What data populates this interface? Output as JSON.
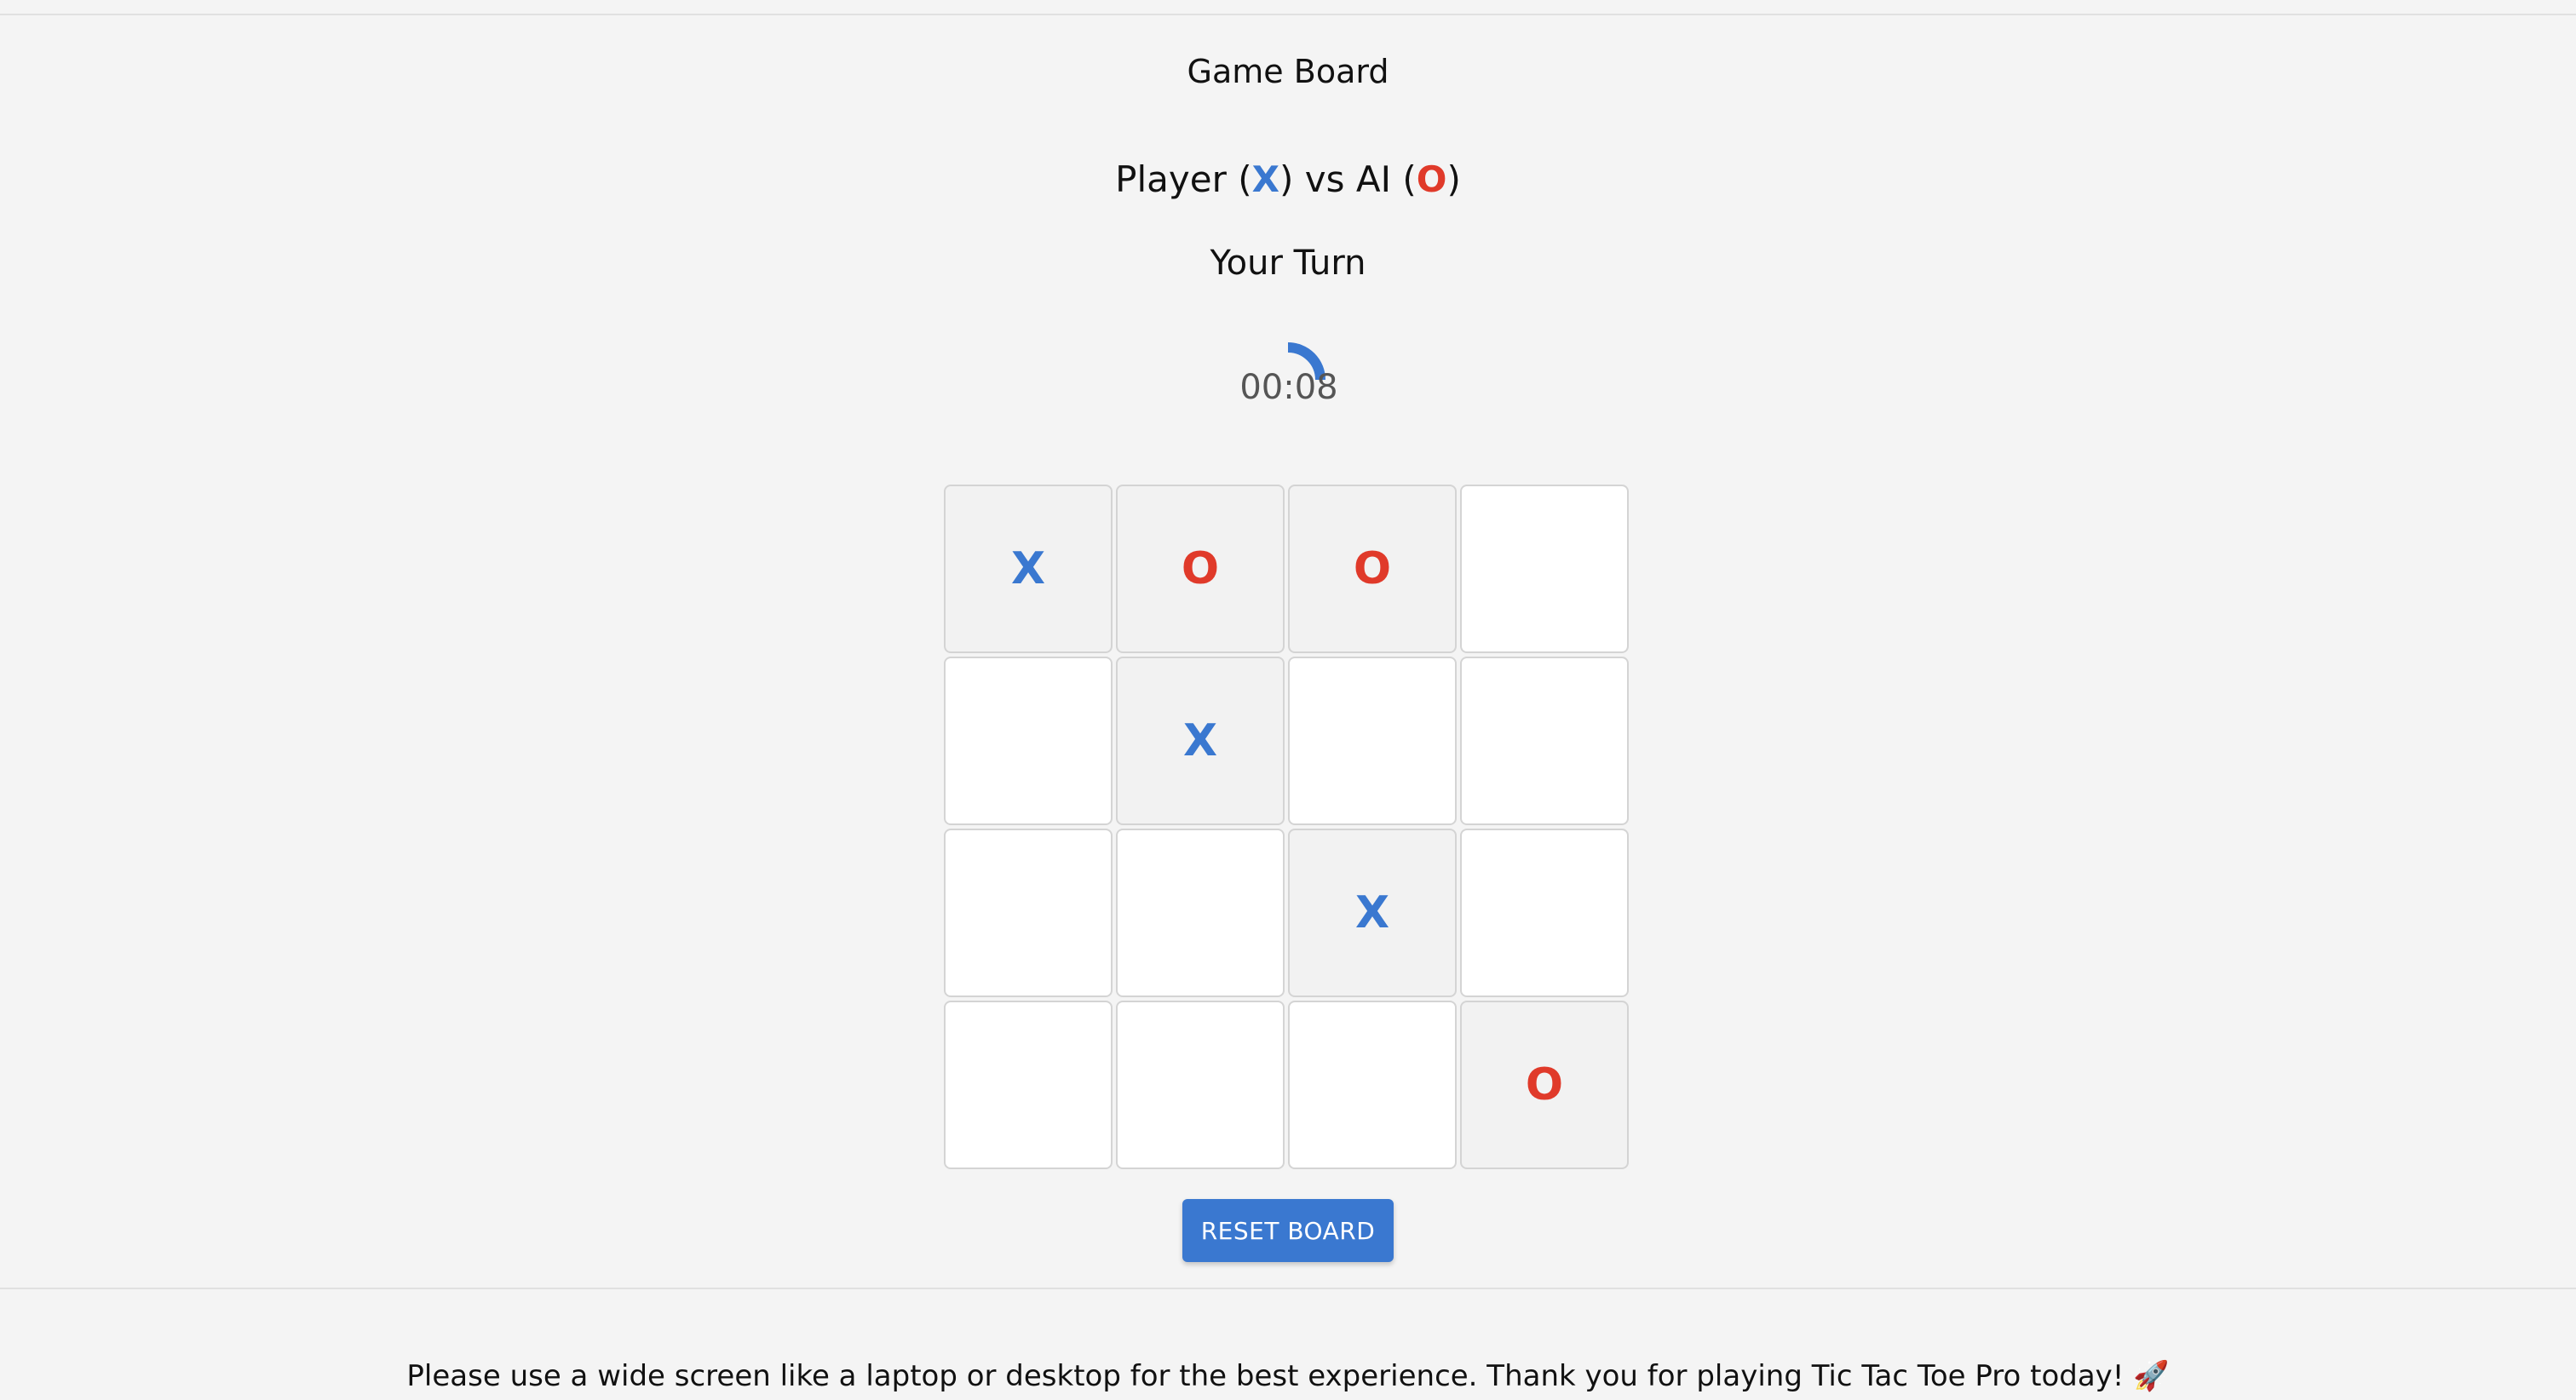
{
  "header": {
    "title": "Game Board"
  },
  "matchup": {
    "player_label": "Player",
    "player_symbol": "X",
    "vs_label": "vs",
    "ai_label": "AI",
    "ai_symbol": "O"
  },
  "status": {
    "turn_text": "Your Turn"
  },
  "timer": {
    "display": "00:08",
    "progress_fraction": 0.25,
    "color": "#3a78d0"
  },
  "board": {
    "size": 4,
    "cells": [
      "X",
      "O",
      "O",
      "",
      "",
      "X",
      "",
      "",
      "",
      "",
      "X",
      "",
      "",
      "",
      "",
      "O"
    ]
  },
  "controls": {
    "reset_label": "RESET BOARD"
  },
  "footer": {
    "message": "Please use a wide screen like a laptop or desktop for the best experience. Thank you for playing Tic Tac Toe Pro today! 🚀"
  },
  "colors": {
    "x_color": "#3a78d0",
    "o_color": "#e03a2a",
    "accent": "#3a78d0"
  }
}
